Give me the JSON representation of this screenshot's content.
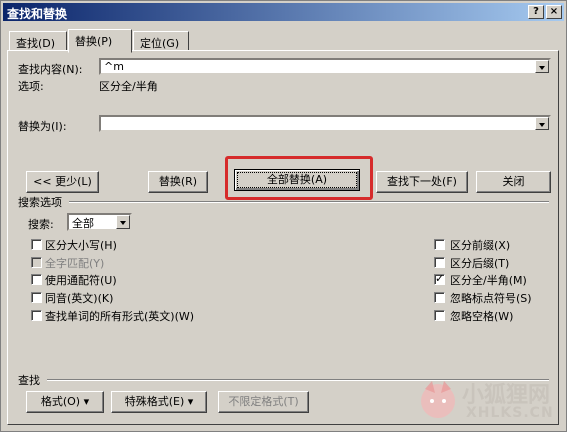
{
  "window": {
    "title": "查找和替换",
    "help_label": "?",
    "close_label": "×"
  },
  "tabs": [
    {
      "label": "查找(D)"
    },
    {
      "label": "替换(P)"
    },
    {
      "label": "定位(G)"
    }
  ],
  "find": {
    "label": "查找内容(N):",
    "value": "^m",
    "options_label": "选项:",
    "options_value": "区分全/半角"
  },
  "replace": {
    "label": "替换为(I):",
    "value": ""
  },
  "buttons": {
    "less": "<< 更少(L)",
    "replace": "替换(R)",
    "replace_all": "全部替换(A)",
    "find_next": "查找下一处(F)",
    "close": "关闭"
  },
  "search_options": {
    "header": "搜索选项",
    "search_label": "搜索:",
    "search_value": "全部",
    "left": [
      {
        "label": "区分大小写(H)",
        "checked": false,
        "disabled": false
      },
      {
        "label": "全字匹配(Y)",
        "checked": false,
        "disabled": true
      },
      {
        "label": "使用通配符(U)",
        "checked": false,
        "disabled": false
      },
      {
        "label": "同音(英文)(K)",
        "checked": false,
        "disabled": false
      },
      {
        "label": "查找单词的所有形式(英文)(W)",
        "checked": false,
        "disabled": false
      }
    ],
    "right": [
      {
        "label": "区分前缀(X)",
        "checked": false
      },
      {
        "label": "区分后缀(T)",
        "checked": false
      },
      {
        "label": "区分全/半角(M)",
        "checked": true
      },
      {
        "label": "忽略标点符号(S)",
        "checked": false
      },
      {
        "label": "忽略空格(W)",
        "checked": false
      }
    ]
  },
  "bottom": {
    "header": "查找",
    "format": "格式(O) ▾",
    "special": "特殊格式(E) ▾",
    "no_format": "不限定格式(T)"
  },
  "watermark": {
    "cn": "小狐狸网",
    "en": "XHLKS.CN"
  },
  "colors": {
    "highlight": "#d62b2b",
    "titlebar": "#0a246a"
  }
}
